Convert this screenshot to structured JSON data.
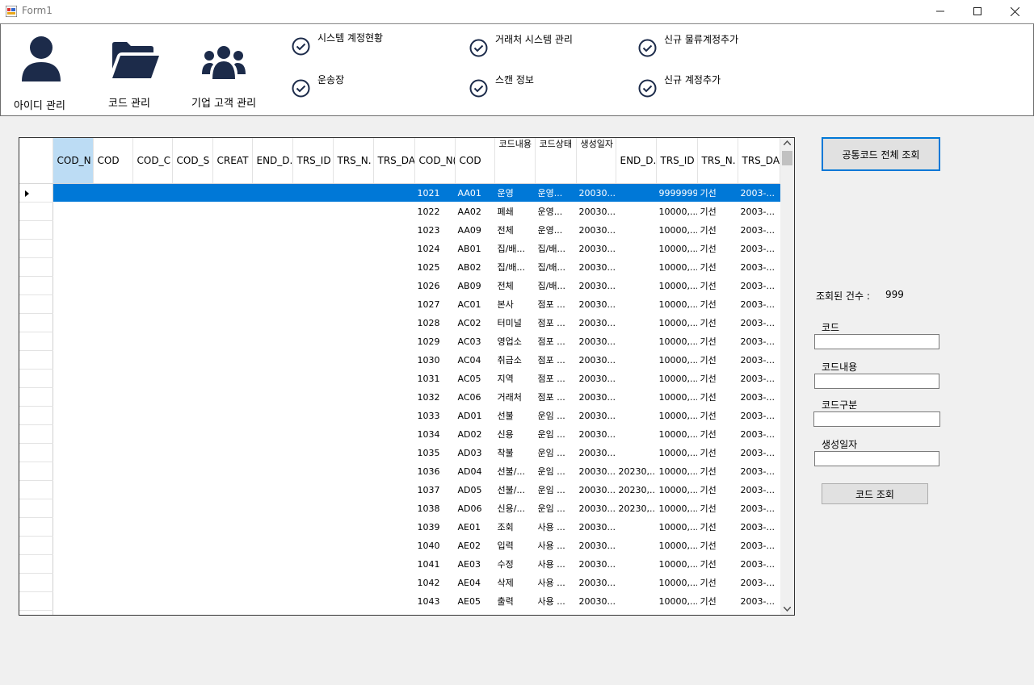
{
  "window": {
    "title": "Form1",
    "minimize": "—",
    "maximize": "☐",
    "close": "✕"
  },
  "toolbar": {
    "id_manage": "아이디 관리",
    "code_manage": "코드 관리",
    "corp_manage": "기업 고객 관리",
    "checks": [
      {
        "label": "시스템 계정현황"
      },
      {
        "label": "거래처 시스템 관리"
      },
      {
        "label": "신규 물류계정추가"
      },
      {
        "label": "운송장"
      },
      {
        "label": "스캔 정보"
      },
      {
        "label": "신규 계정추가"
      }
    ]
  },
  "grid": {
    "columns": [
      "COD_N",
      "COD",
      "COD_C",
      "COD_S",
      "CREAT",
      "END_D.",
      "TRS_ID",
      "TRS_N.",
      "TRS_DA",
      "COD_N(",
      "COD",
      "코드내용",
      "코드상태",
      "생성일자",
      "END_D.",
      "TRS_ID",
      "TRS_N.",
      "TRS_DA"
    ],
    "rows": [
      [
        "1021",
        "AA01",
        "운영",
        "운영...",
        "20030...",
        "",
        "9999999",
        "기선",
        "2003-..."
      ],
      [
        "1022",
        "AA02",
        "폐쇄",
        "운영...",
        "20030...",
        "",
        "10000,...",
        "기선",
        "2003-..."
      ],
      [
        "1023",
        "AA09",
        "전체",
        "운영...",
        "20030...",
        "",
        "10000,...",
        "기선",
        "2003-..."
      ],
      [
        "1024",
        "AB01",
        "집/배...",
        "집/배...",
        "20030...",
        "",
        "10000,...",
        "기선",
        "2003-..."
      ],
      [
        "1025",
        "AB02",
        "집/배...",
        "집/배...",
        "20030...",
        "",
        "10000,...",
        "기선",
        "2003-..."
      ],
      [
        "1026",
        "AB09",
        "전체",
        "집/배...",
        "20030...",
        "",
        "10000,...",
        "기선",
        "2003-..."
      ],
      [
        "1027",
        "AC01",
        "본사",
        "점포 ...",
        "20030...",
        "",
        "10000,...",
        "기선",
        "2003-..."
      ],
      [
        "1028",
        "AC02",
        "터미널",
        "점포 ...",
        "20030...",
        "",
        "10000,...",
        "기선",
        "2003-..."
      ],
      [
        "1029",
        "AC03",
        "영업소",
        "점포 ...",
        "20030...",
        "",
        "10000,...",
        "기선",
        "2003-..."
      ],
      [
        "1030",
        "AC04",
        "취급소",
        "점포 ...",
        "20030...",
        "",
        "10000,...",
        "기선",
        "2003-..."
      ],
      [
        "1031",
        "AC05",
        "지역",
        "점포 ...",
        "20030...",
        "",
        "10000,...",
        "기선",
        "2003-..."
      ],
      [
        "1032",
        "AC06",
        "거래처",
        "점포 ...",
        "20030...",
        "",
        "10000,...",
        "기선",
        "2003-..."
      ],
      [
        "1033",
        "AD01",
        "선불",
        "운임 ...",
        "20030...",
        "",
        "10000,...",
        "기선",
        "2003-..."
      ],
      [
        "1034",
        "AD02",
        "신용",
        "운임 ...",
        "20030...",
        "",
        "10000,...",
        "기선",
        "2003-..."
      ],
      [
        "1035",
        "AD03",
        "착불",
        "운임 ...",
        "20030...",
        "",
        "10000,...",
        "기선",
        "2003-..."
      ],
      [
        "1036",
        "AD04",
        "선불/...",
        "운임 ...",
        "20030...",
        "20230,...",
        "10000,...",
        "기선",
        "2003-..."
      ],
      [
        "1037",
        "AD05",
        "선불/...",
        "운임 ...",
        "20030...",
        "20230,...",
        "10000,...",
        "기선",
        "2003-..."
      ],
      [
        "1038",
        "AD06",
        "신용/...",
        "운임 ...",
        "20030...",
        "20230,...",
        "10000,...",
        "기선",
        "2003-..."
      ],
      [
        "1039",
        "AE01",
        "조회",
        "사용 ...",
        "20030...",
        "",
        "10000,...",
        "기선",
        "2003-..."
      ],
      [
        "1040",
        "AE02",
        "입력",
        "사용 ...",
        "20030...",
        "",
        "10000,...",
        "기선",
        "2003-..."
      ],
      [
        "1041",
        "AE03",
        "수정",
        "사용 ...",
        "20030...",
        "",
        "10000,...",
        "기선",
        "2003-..."
      ],
      [
        "1042",
        "AE04",
        "삭제",
        "사용 ...",
        "20030...",
        "",
        "10000,...",
        "기선",
        "2003-..."
      ],
      [
        "1043",
        "AE05",
        "출력",
        "사용 ...",
        "20030...",
        "",
        "10000,...",
        "기선",
        "2003-..."
      ]
    ]
  },
  "side": {
    "btn_all": "공통코드 전체 조회",
    "count_label": "조회된 건수 :",
    "count_value": "999",
    "code_label": "코드",
    "content_label": "코드내용",
    "div_label": "코드구분",
    "date_label": "생성일자",
    "btn_search": "코드 조회"
  }
}
